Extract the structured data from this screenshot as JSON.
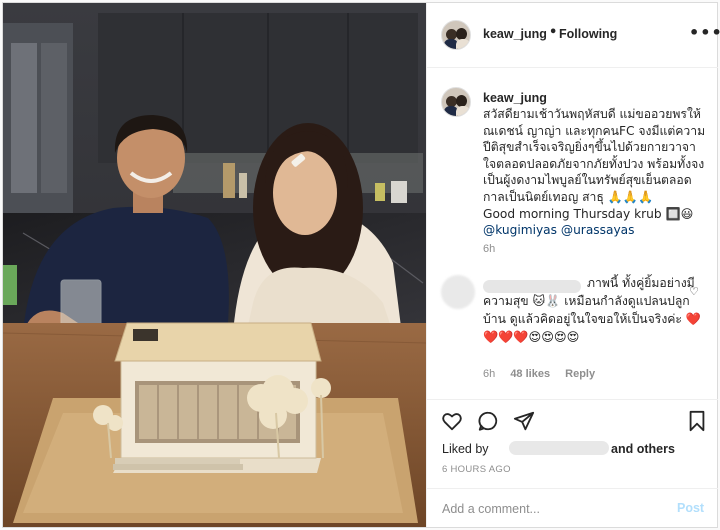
{
  "post": {
    "username": "keaw_jung",
    "separator": "•",
    "follow_status": "Following",
    "more_icon": "more-dots-icon",
    "caption": {
      "username": "keaw_jung",
      "text": "สวัสดียามเช้าวันพฤหัสบดี แม่ขออวยพรให้ณเดชน์ ญาญ่า และทุกคนFC จงมีแต่ความปีติสุขสำเร็จเจริญยิ่งๆขึ้นไปด้วยกายวาจาใจตลอดปลอดภัยจากภัยทั้งปวง พร้อมทั้งจงเป็นผู้งดงามไพบูลย์ในทรัพย์สุขเย็นตลอดกาลเป็นนิตย์เทอญ สาธุ 🙏🙏🙏\nGood morning Thursday krub 🔲😃\n",
      "mentions": [
        "@kugimiyas",
        "@urassayas"
      ],
      "time": "6h"
    },
    "comment": {
      "text": "ภาพนี้ ทั้งคู่ยิ้มอย่างมีความสุข 🐱🐰 เหมือนกำลังดูแปลนปลูกบ้าน ดูแล้วคิดอยู่ในใจขอให้เป็นจริงค่ะ ❤️❤️❤️❤️😍😍😍😍",
      "time": "6h",
      "likes": "48 likes",
      "reply": "Reply",
      "heart_icon": "heart-outline-icon"
    },
    "liked_by_label": "Liked by",
    "liked_by_others": "and others",
    "time_ago": "6 HOURS AGO",
    "add_comment_placeholder": "Add a comment...",
    "post_button": "Post",
    "colors": {
      "link": "#003569",
      "muted": "#8e8e8e",
      "post_disabled": "#b2dffc",
      "border": "#efefef"
    },
    "icons": [
      "heart-icon",
      "comment-icon",
      "share-icon",
      "bookmark-icon"
    ]
  }
}
